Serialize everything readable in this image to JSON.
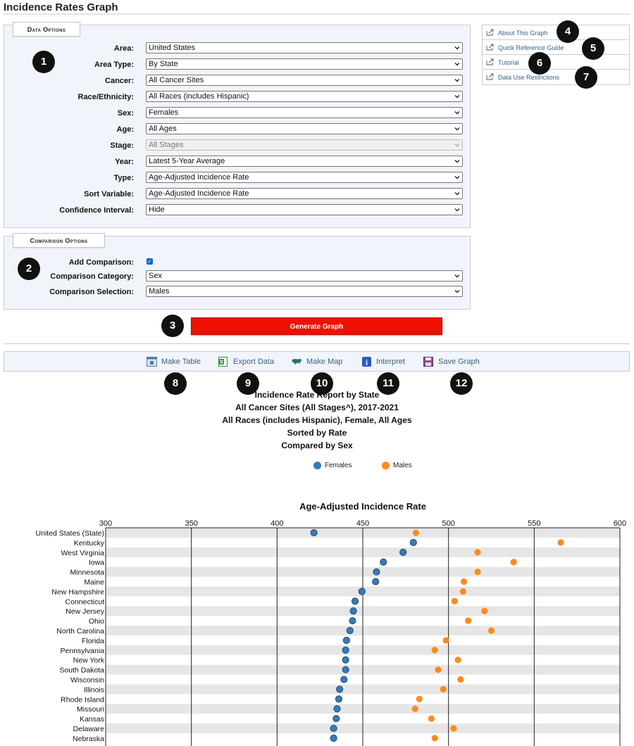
{
  "page": {
    "title": "Incidence Rates Graph"
  },
  "data_options": {
    "legend": "Data Options",
    "rows": [
      {
        "label": "Area:",
        "value": "United States",
        "disabled": false
      },
      {
        "label": "Area Type:",
        "value": "By State",
        "disabled": false
      },
      {
        "label": "Cancer:",
        "value": "All Cancer Sites",
        "disabled": false
      },
      {
        "label": "Race/Ethnicity:",
        "value": "All Races (includes Hispanic)",
        "disabled": false
      },
      {
        "label": "Sex:",
        "value": "Females",
        "disabled": false
      },
      {
        "label": "Age:",
        "value": "All Ages",
        "disabled": false
      },
      {
        "label": "Stage:",
        "value": "All Stages",
        "disabled": true
      },
      {
        "label": "Year:",
        "value": "Latest 5-Year Average",
        "disabled": false
      },
      {
        "label": "Type:",
        "value": "Age-Adjusted Incidence Rate",
        "disabled": false
      },
      {
        "label": "Sort Variable:",
        "value": "Age-Adjusted Incidence Rate",
        "disabled": false
      },
      {
        "label": "Confidence Interval:",
        "value": "Hide",
        "disabled": false
      }
    ]
  },
  "comparison_options": {
    "legend": "Comparison Options",
    "add_comparison_label": "Add Comparison:",
    "add_comparison_checked": true,
    "category_label": "Comparison Category:",
    "category_value": "Sex",
    "selection_label": "Comparison Selection:",
    "selection_value": "Males"
  },
  "badges": [
    "1",
    "2",
    "3",
    "4",
    "5",
    "6",
    "7",
    "8",
    "9",
    "10",
    "11",
    "12"
  ],
  "side_links": [
    "About This Graph",
    "Quick Reference Guide",
    "Tutorial",
    "Data Use Restrictions"
  ],
  "generate_button": "Generate Graph",
  "toolbar": {
    "make_table": "Make Table",
    "export_data": "Export Data",
    "make_map": "Make Map",
    "interpret": "Interpret",
    "save_graph": "Save Graph"
  },
  "colors": {
    "females": "#3a7ab8",
    "males": "#ff8a1e",
    "generate": "#ee1100"
  },
  "chart_data": {
    "type": "scatter",
    "title_lines": [
      "Incidence Rate Report by State",
      "All Cancer Sites (All Stages^), 2017-2021",
      "All Races (includes Hispanic), Female, All Ages",
      "Sorted by Rate",
      "Compared by Sex"
    ],
    "axis_title": "Age-Adjusted Incidence Rate",
    "xlim": [
      300,
      600
    ],
    "xticks": [
      "300",
      "350",
      "400",
      "450",
      "500",
      "550",
      "600"
    ],
    "categories": [
      "United States (State)",
      "Kentucky",
      "West Virginia",
      "Iowa",
      "Minnesota",
      "Maine",
      "New Hampshire",
      "Connecticut",
      "New Jersey",
      "Ohio",
      "North Carolina",
      "Florida",
      "Pennsylvania",
      "New York",
      "South Dakota",
      "Wisconsin",
      "Illinois",
      "Rhode Island",
      "Missouri",
      "Kansas",
      "Delaware",
      "Nebraska"
    ],
    "series": [
      {
        "name": "Females",
        "values": [
          421.5,
          479.5,
          473.5,
          462.0,
          458.0,
          457.5,
          449.5,
          445.5,
          444.5,
          444.0,
          442.5,
          440.5,
          440.0,
          440.0,
          440.0,
          439.0,
          436.5,
          436.0,
          435.0,
          434.5,
          433.0,
          433.0
        ]
      },
      {
        "name": "Males",
        "values": [
          481.0,
          565.5,
          517.0,
          538.0,
          517.0,
          509.0,
          508.5,
          503.5,
          521.0,
          511.5,
          525.0,
          498.5,
          492.0,
          505.5,
          494.0,
          507.0,
          497.0,
          483.0,
          480.5,
          490.0,
          503.0,
          492.0
        ]
      }
    ],
    "legend_position": "top-center",
    "grid": true
  }
}
